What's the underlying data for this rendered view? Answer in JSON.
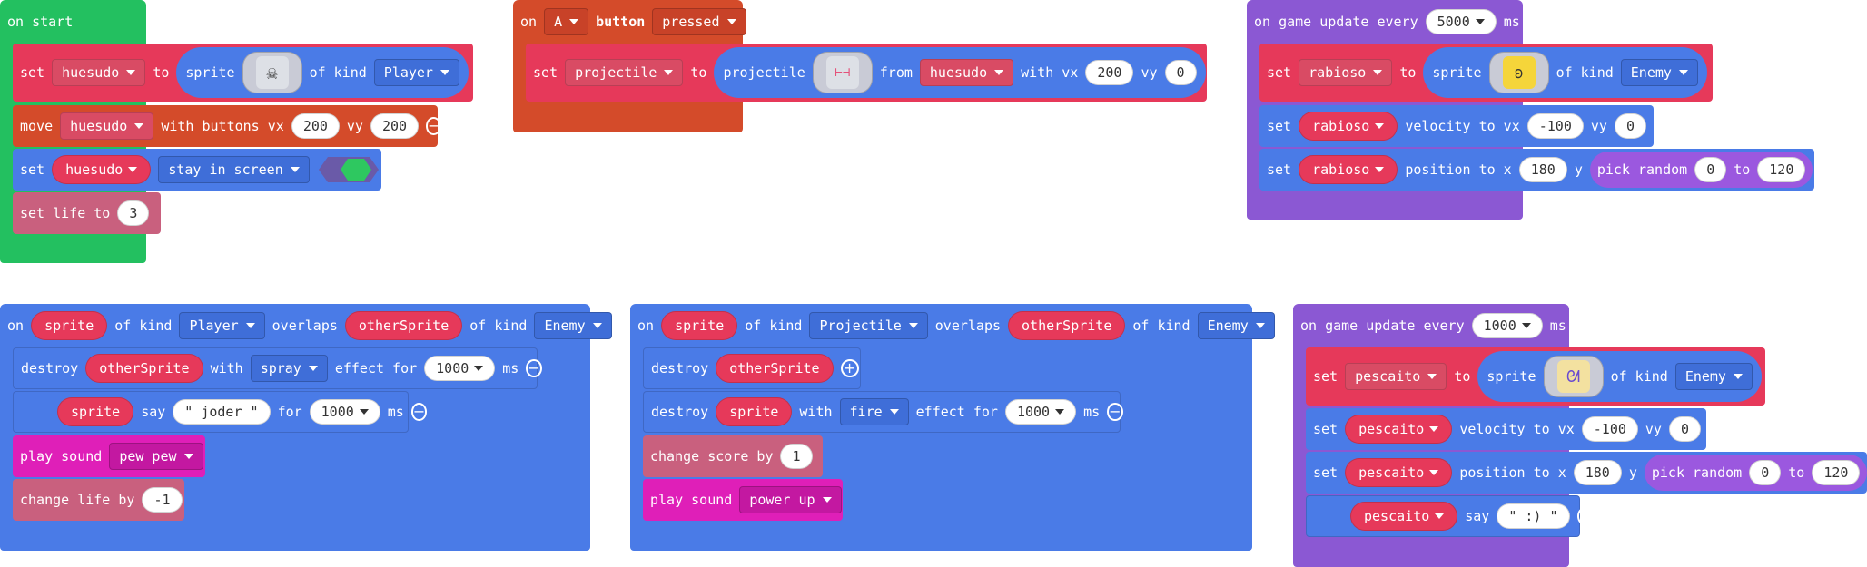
{
  "on_start": {
    "hat_label": "on start",
    "set_sprite": {
      "set": "set",
      "var": "huesudo",
      "to": "to",
      "sprite": "sprite",
      "of_kind": "of kind",
      "kind": "Player"
    },
    "move": {
      "label": "move",
      "var": "huesudo",
      "with_buttons": "with buttons vx",
      "vx": "200",
      "vy_label": "vy",
      "vy": "200"
    },
    "stay": {
      "set": "set",
      "var": "huesudo",
      "option": "stay in screen",
      "toggle": "ON"
    },
    "life": {
      "label": "set life to",
      "value": "3"
    }
  },
  "on_a": {
    "on": "on",
    "button": "A",
    "button_label": "button",
    "event": "pressed",
    "set": "set",
    "var": "projectile",
    "to": "to",
    "projectile": "projectile",
    "from": "from",
    "from_var": "huesudo",
    "with_vx": "with vx",
    "vx": "200",
    "vy_label": "vy",
    "vy": "0"
  },
  "update_5000": {
    "hat_pre": "on game update every",
    "interval": "5000",
    "hat_post": "ms",
    "set_sprite": {
      "set": "set",
      "var": "rabioso",
      "to": "to",
      "sprite": "sprite",
      "of_kind": "of kind",
      "kind": "Enemy"
    },
    "velocity": {
      "set": "set",
      "var": "rabioso",
      "label": "velocity to vx",
      "vx": "-100",
      "vy_label": "vy",
      "vy": "0"
    },
    "position": {
      "set": "set",
      "var": "rabioso",
      "label": "position to x",
      "x": "180",
      "y_label": "y",
      "pick": "pick random",
      "from": "0",
      "to_label": "to",
      "to": "120"
    }
  },
  "overlap_player": {
    "on": "on",
    "var1": "sprite",
    "of_kind": "of kind",
    "kind1": "Player",
    "overlaps": "overlaps",
    "var2": "otherSprite",
    "of_kind2": "of kind",
    "kind2": "Enemy",
    "destroy": {
      "label": "destroy",
      "var": "otherSprite",
      "with": "with",
      "effect": "spray",
      "effect_for": "effect for",
      "ms_value": "1000",
      "ms": "ms"
    },
    "say": {
      "var": "sprite",
      "say": "say",
      "text": "\" joder \"",
      "for": "for",
      "ms_value": "1000",
      "ms": "ms"
    },
    "sound": {
      "label": "play sound",
      "sound": "pew pew"
    },
    "life": {
      "label": "change life by",
      "value": "-1"
    }
  },
  "overlap_projectile": {
    "on": "on",
    "var1": "sprite",
    "of_kind": "of kind",
    "kind1": "Projectile",
    "overlaps": "overlaps",
    "var2": "otherSprite",
    "of_kind2": "of kind",
    "kind2": "Enemy",
    "destroy1": {
      "label": "destroy",
      "var": "otherSprite"
    },
    "destroy2": {
      "label": "destroy",
      "var": "sprite",
      "with": "with",
      "effect": "fire",
      "effect_for": "effect for",
      "ms_value": "1000",
      "ms": "ms"
    },
    "score": {
      "label": "change score by",
      "value": "1"
    },
    "sound": {
      "label": "play sound",
      "sound": "power up"
    }
  },
  "update_1000": {
    "hat_pre": "on game update every",
    "interval": "1000",
    "hat_post": "ms",
    "set_sprite": {
      "set": "set",
      "var": "pescaito",
      "to": "to",
      "sprite": "sprite",
      "of_kind": "of kind",
      "kind": "Enemy"
    },
    "velocity": {
      "set": "set",
      "var": "pescaito",
      "label": "velocity to vx",
      "vx": "-100",
      "vy_label": "vy",
      "vy": "0"
    },
    "position": {
      "set": "set",
      "var": "pescaito",
      "label": "position to x",
      "x": "180",
      "y_label": "y",
      "pick": "pick random",
      "from": "0",
      "to_label": "to",
      "to": "120"
    },
    "say": {
      "var": "pescaito",
      "say": "say",
      "text": "\" :) \""
    }
  }
}
